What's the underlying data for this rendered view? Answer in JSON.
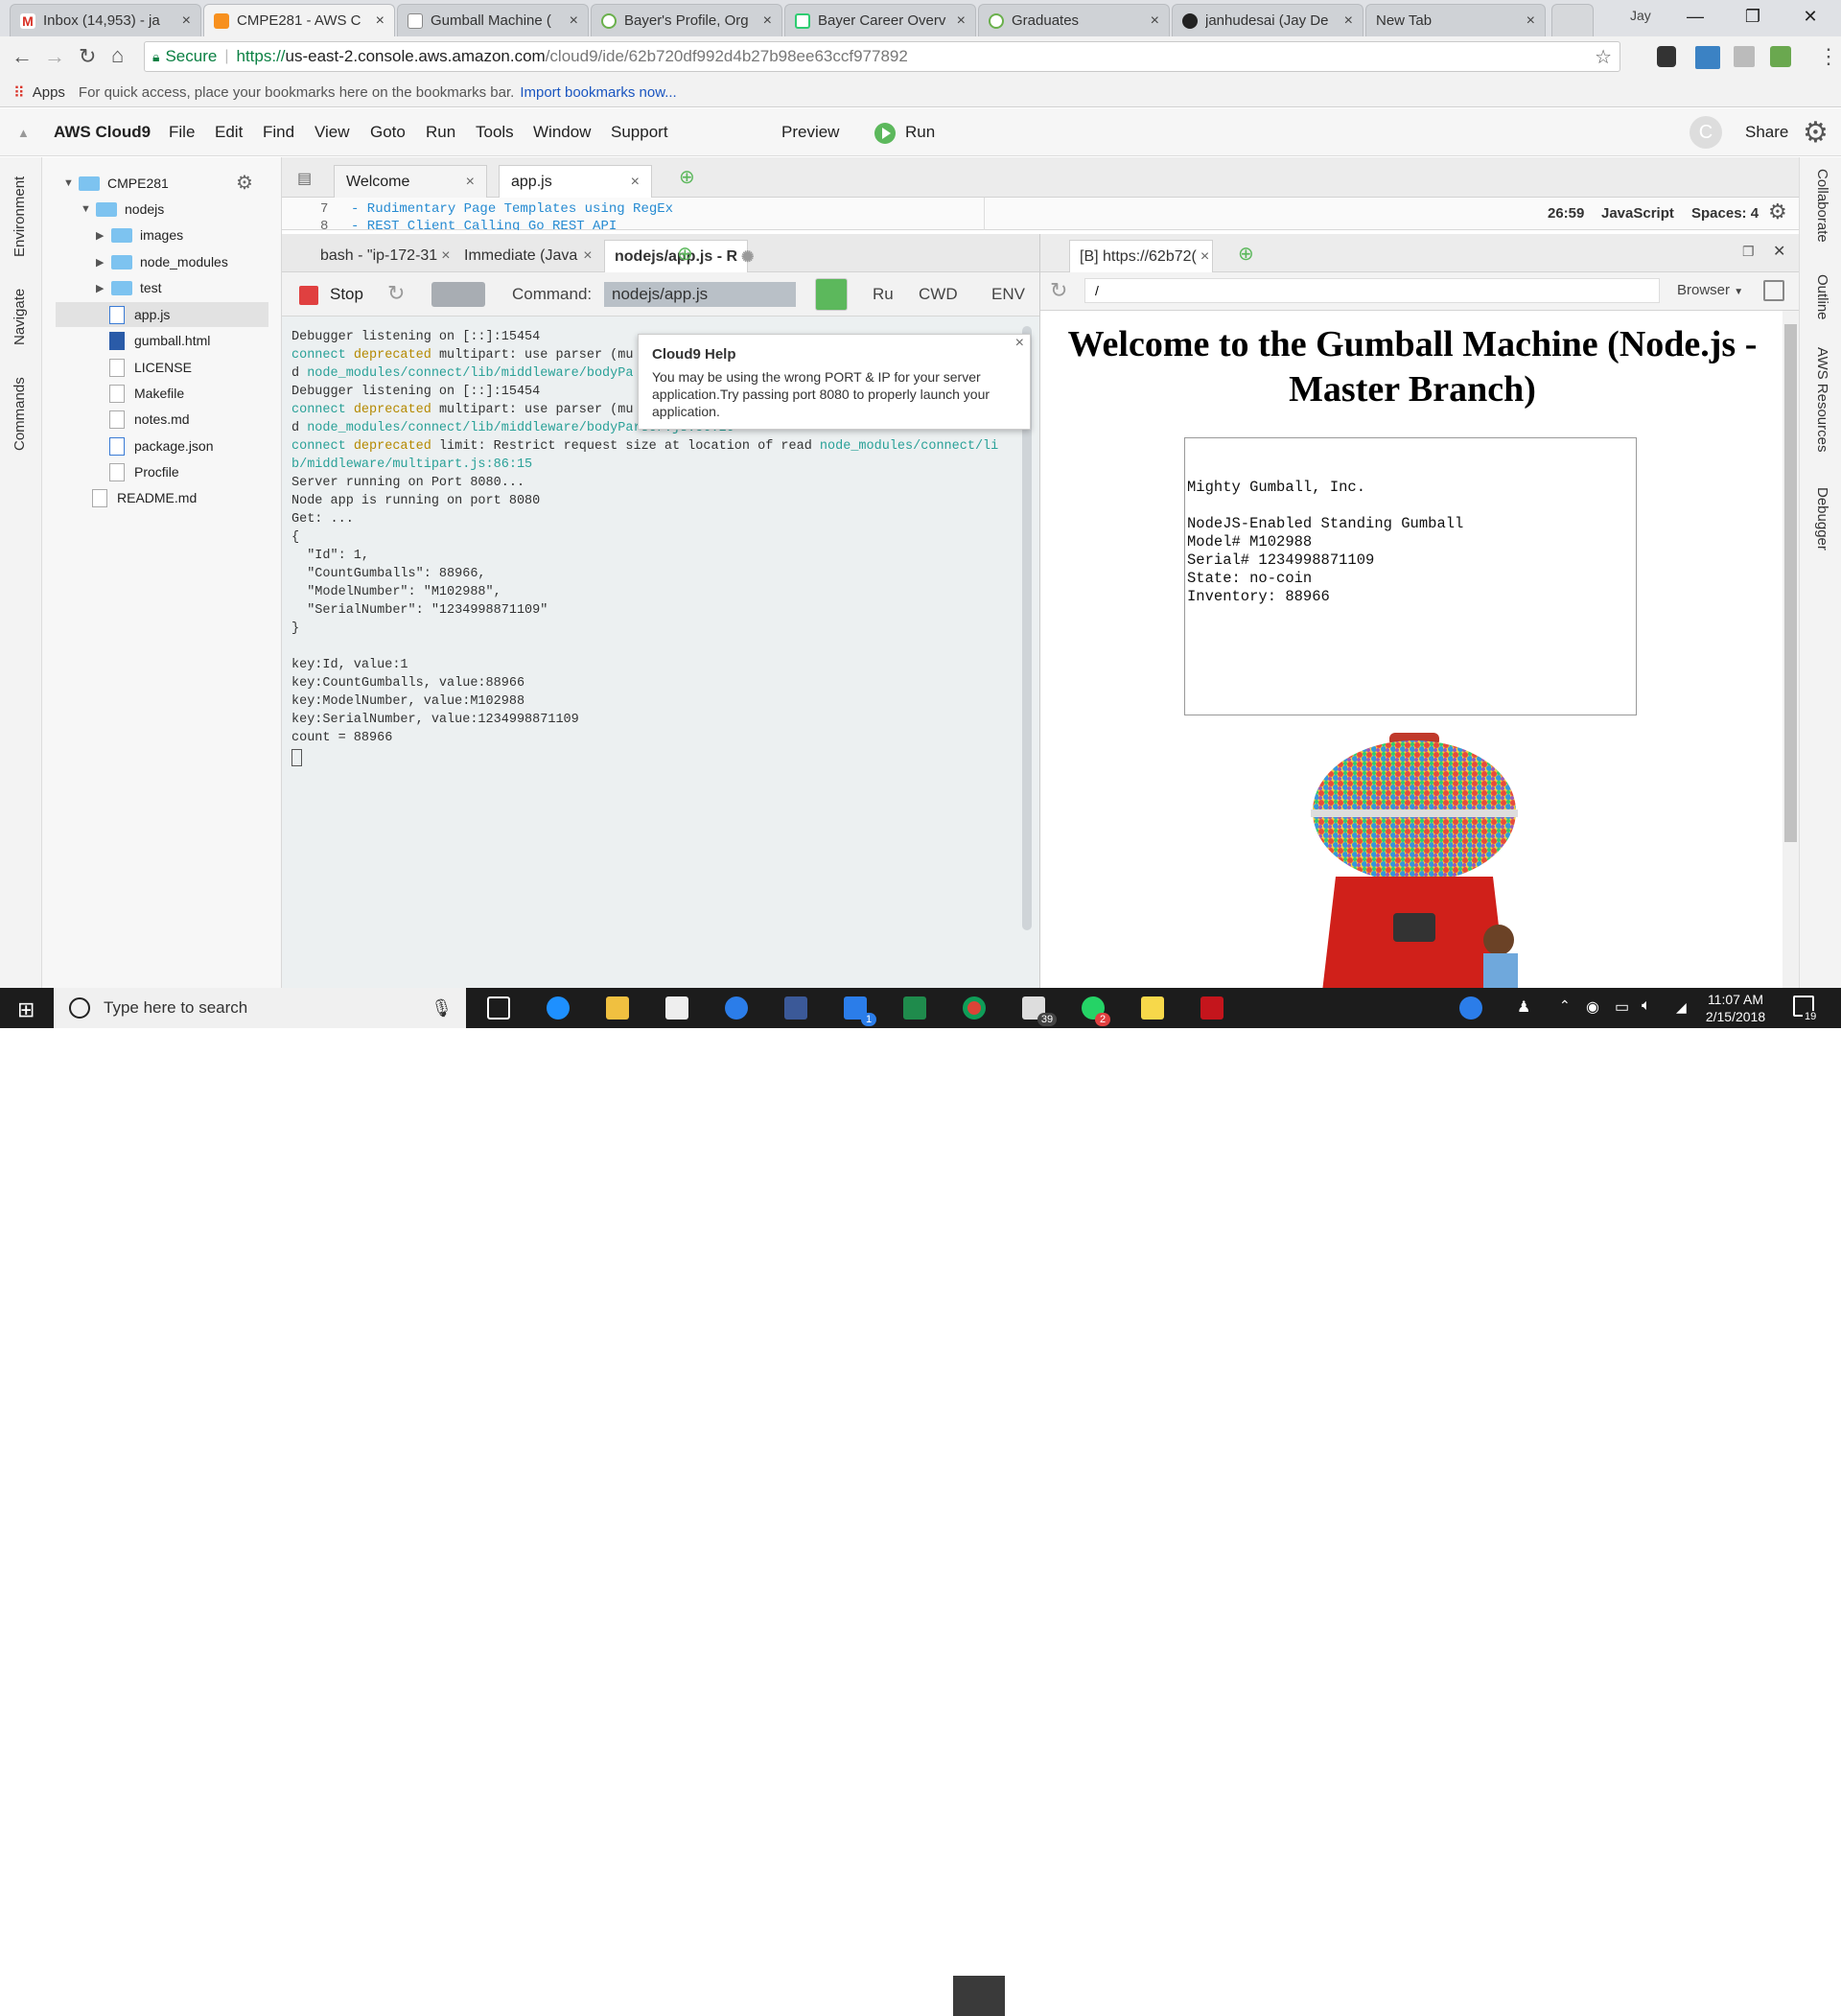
{
  "browser": {
    "tabs": [
      {
        "label": "Inbox (14,953) - ja",
        "icon": "gmail-icon"
      },
      {
        "label": "CMPE281 - AWS C",
        "icon": "aws-cube-icon"
      },
      {
        "label": "Gumball Machine (",
        "icon": "page-icon"
      },
      {
        "label": "Bayer's Profile, Org",
        "icon": "bayer-icon"
      },
      {
        "label": "Bayer Career Overv",
        "icon": "doc-icon"
      },
      {
        "label": "Graduates",
        "icon": "bayer-icon"
      },
      {
        "label": "janhudesai (Jay De",
        "icon": "github-icon"
      },
      {
        "label": "New Tab",
        "icon": "none"
      }
    ],
    "user": "Jay",
    "secure_label": "Secure",
    "url_prefix": "https://",
    "url_host": "us-east-2.console.aws.amazon.com",
    "url_path": "/cloud9/ide/62b720df992d4b27b98ee63ccf977892",
    "bookmarks_apps": "Apps",
    "bookmarks_hint": "For quick access, place your bookmarks here on the bookmarks bar.",
    "bookmarks_link": "Import bookmarks now..."
  },
  "ide": {
    "brand": "AWS Cloud9",
    "menu": [
      "File",
      "Edit",
      "Find",
      "View",
      "Goto",
      "Run",
      "Tools",
      "Window",
      "Support"
    ],
    "preview_label": "Preview",
    "run_label": "Run",
    "avatar_letter": "C",
    "share_label": "Share",
    "left_panels": [
      "Environment",
      "Navigate",
      "Commands"
    ],
    "right_panels": [
      "Collaborate",
      "Outline",
      "AWS Resources",
      "Debugger"
    ],
    "tree": {
      "root": "CMPE281",
      "folder": "nodejs",
      "subfolders": [
        "images",
        "node_modules",
        "test"
      ],
      "files": [
        "app.js",
        "gumball.html",
        "LICENSE",
        "Makefile",
        "notes.md",
        "package.json",
        "Procfile"
      ],
      "root_files": [
        "README.md"
      ]
    },
    "editor_tabs": [
      "Welcome",
      "app.js"
    ],
    "code_lines": [
      {
        "num": "7",
        "text": "- Rudimentary Page Templates using RegEx"
      },
      {
        "num": "8",
        "text": "- REST Client Calling Go REST API"
      }
    ],
    "status": {
      "cursor": "26:59",
      "language": "JavaScript",
      "spaces": "Spaces: 4"
    },
    "terminal_tabs": [
      "bash - \"ip-172-31",
      "Immediate (Java",
      "nodejs/app.js - R"
    ],
    "runner": {
      "stop_label": "Stop",
      "command_label": "Command:",
      "command_value": "nodejs/app.js",
      "runner_label": "Ru",
      "cwd_label": "CWD",
      "env_label": "ENV"
    },
    "terminal": {
      "l1": "Debugger listening on [::]:15454",
      "l2a": "connect",
      "l2b": "deprecated",
      "l2c": " multipart: use parser (mu",
      "l3a": "d ",
      "l3b": "node_modules/connect/lib/middleware/bodyPa",
      "l4": "Debugger listening on [::]:15454",
      "l5a": "connect",
      "l5b": "deprecated",
      "l5c": " multipart: use parser (mu",
      "l6a": "d ",
      "l6b": "node_modules/connect/lib/middleware/bodyParser.js:56:20",
      "l7a": "connect",
      "l7b": "deprecated",
      "l7c": " limit: Restrict request size at location of read ",
      "l7d": "node_modules/connect/li",
      "l8": "b/middleware/multipart.js:86:15",
      "l9": "Server running on Port 8080...",
      "l10": "Node app is running on port 8080",
      "l11": "Get: ...",
      "l12": "{",
      "l13": "  \"Id\": 1,",
      "l14": "  \"CountGumballs\": 88966,",
      "l15": "  \"ModelNumber\": \"M102988\",",
      "l16": "  \"SerialNumber\": \"1234998871109\"",
      "l17": "}",
      "l18": "key:Id, value:1",
      "l19": "key:CountGumballs, value:88966",
      "l20": "key:ModelNumber, value:M102988",
      "l21": "key:SerialNumber, value:1234998871109",
      "l22": "count = 88966"
    },
    "popup": {
      "title": "Cloud9 Help",
      "body": "You may be using the wrong PORT & IP for your server application.Try passing port 8080 to properly launch your application."
    },
    "preview": {
      "tab": "[B] https://62b72(",
      "path": "/",
      "browser_label": "Browser",
      "heading": "Welcome to the Gumball Machine (Node.js - Master Branch)",
      "box_lines": [
        "Mighty Gumball, Inc.",
        "NodeJS-Enabled Standing Gumball",
        "Model# M102988",
        "Serial# 1234998871109",
        "State: no-coin",
        "Inventory: 88966"
      ]
    }
  },
  "taskbar": {
    "search_placeholder": "Type here to search",
    "mail_badge": "39",
    "whatsapp_badge": "2",
    "instagram_badge": "1",
    "time": "11:07 AM",
    "date": "2/15/2018",
    "notif_count": "19"
  },
  "colors": {
    "run_green": "#5cb85c",
    "stop_red": "#e04040",
    "terminal_bg": "#ecf0f1",
    "teal": "#2aa198",
    "mustard": "#b58900"
  }
}
